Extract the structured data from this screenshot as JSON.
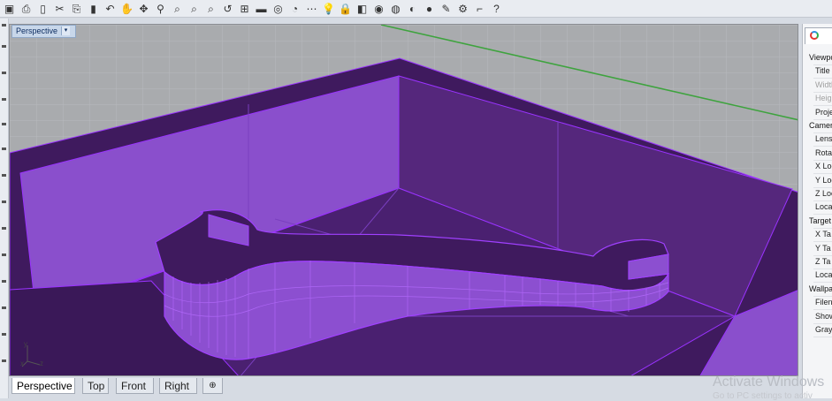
{
  "toolbar": {
    "icons": [
      "save-icon",
      "print-icon",
      "new-icon",
      "cut-icon",
      "copy-icon",
      "paste-icon",
      "undo-icon",
      "pan-icon",
      "rotate-icon",
      "zoom-icon",
      "zoom-window-icon",
      "zoom-extents-icon",
      "zoom-selected-icon",
      "undo-view-icon",
      "grid-icon",
      "car-icon",
      "render-eye-icon",
      "circle-icon",
      "points-icon",
      "light-icon",
      "lock-icon",
      "box-icon",
      "color-wheel-icon",
      "sphere-icon",
      "shaded-sphere-icon",
      "blue-sphere-icon",
      "pen-icon",
      "gear-icon",
      "layout-icon",
      "help-icon"
    ],
    "glyphs": [
      "▣",
      "⎙",
      "▯",
      "✂",
      "⎘",
      "▮",
      "↶",
      "✋",
      "✥",
      "⚲",
      "⌕",
      "⌕",
      "⌕",
      "↺",
      "⊞",
      "▬",
      "◎",
      "◔",
      "⋯",
      "💡",
      "🔒",
      "◧",
      "◉",
      "◍",
      "◐",
      "●",
      "✎",
      "⚙",
      "⌐",
      "?"
    ]
  },
  "viewport": {
    "title": "Perspective",
    "dropdown": "▾",
    "axis": {
      "x": "x",
      "y": "y",
      "z": "z"
    },
    "colors": {
      "background": "#a9abae",
      "object": "#8c4fd0",
      "object_dark": "#3f1a5e",
      "edge": "#9a33ff",
      "x_axis": "#3ea33e"
    }
  },
  "tabs": [
    {
      "label": "Perspective",
      "active": true
    },
    {
      "label": "Top",
      "active": false
    },
    {
      "label": "Front",
      "active": false
    },
    {
      "label": "Right",
      "active": false
    },
    {
      "label": "⊕",
      "active": false
    }
  ],
  "panel": {
    "rows": [
      {
        "text": "Viewpo",
        "kind": "section"
      },
      {
        "text": "Title",
        "kind": "item"
      },
      {
        "text": "Width",
        "kind": "item disabled"
      },
      {
        "text": "Heigh",
        "kind": "item disabled"
      },
      {
        "text": "Proje",
        "kind": "item"
      },
      {
        "text": "Camera",
        "kind": "section"
      },
      {
        "text": "Lens",
        "kind": "item"
      },
      {
        "text": "Rotat",
        "kind": "item"
      },
      {
        "text": "X Loc",
        "kind": "item"
      },
      {
        "text": "Y Loc",
        "kind": "item"
      },
      {
        "text": "Z Loc",
        "kind": "item"
      },
      {
        "text": "Loca",
        "kind": "item"
      },
      {
        "text": "Target",
        "kind": "section"
      },
      {
        "text": "X Ta",
        "kind": "item"
      },
      {
        "text": "Y Ta",
        "kind": "item"
      },
      {
        "text": "Z Ta",
        "kind": "item"
      },
      {
        "text": "Loca",
        "kind": "item"
      },
      {
        "text": "Wallpa",
        "kind": "section"
      },
      {
        "text": "Filena",
        "kind": "item"
      },
      {
        "text": "Show",
        "kind": "item"
      },
      {
        "text": "Gray",
        "kind": "item"
      }
    ]
  },
  "watermark": {
    "title": "Activate Windows",
    "subtitle": "Go to PC settings to activ"
  }
}
